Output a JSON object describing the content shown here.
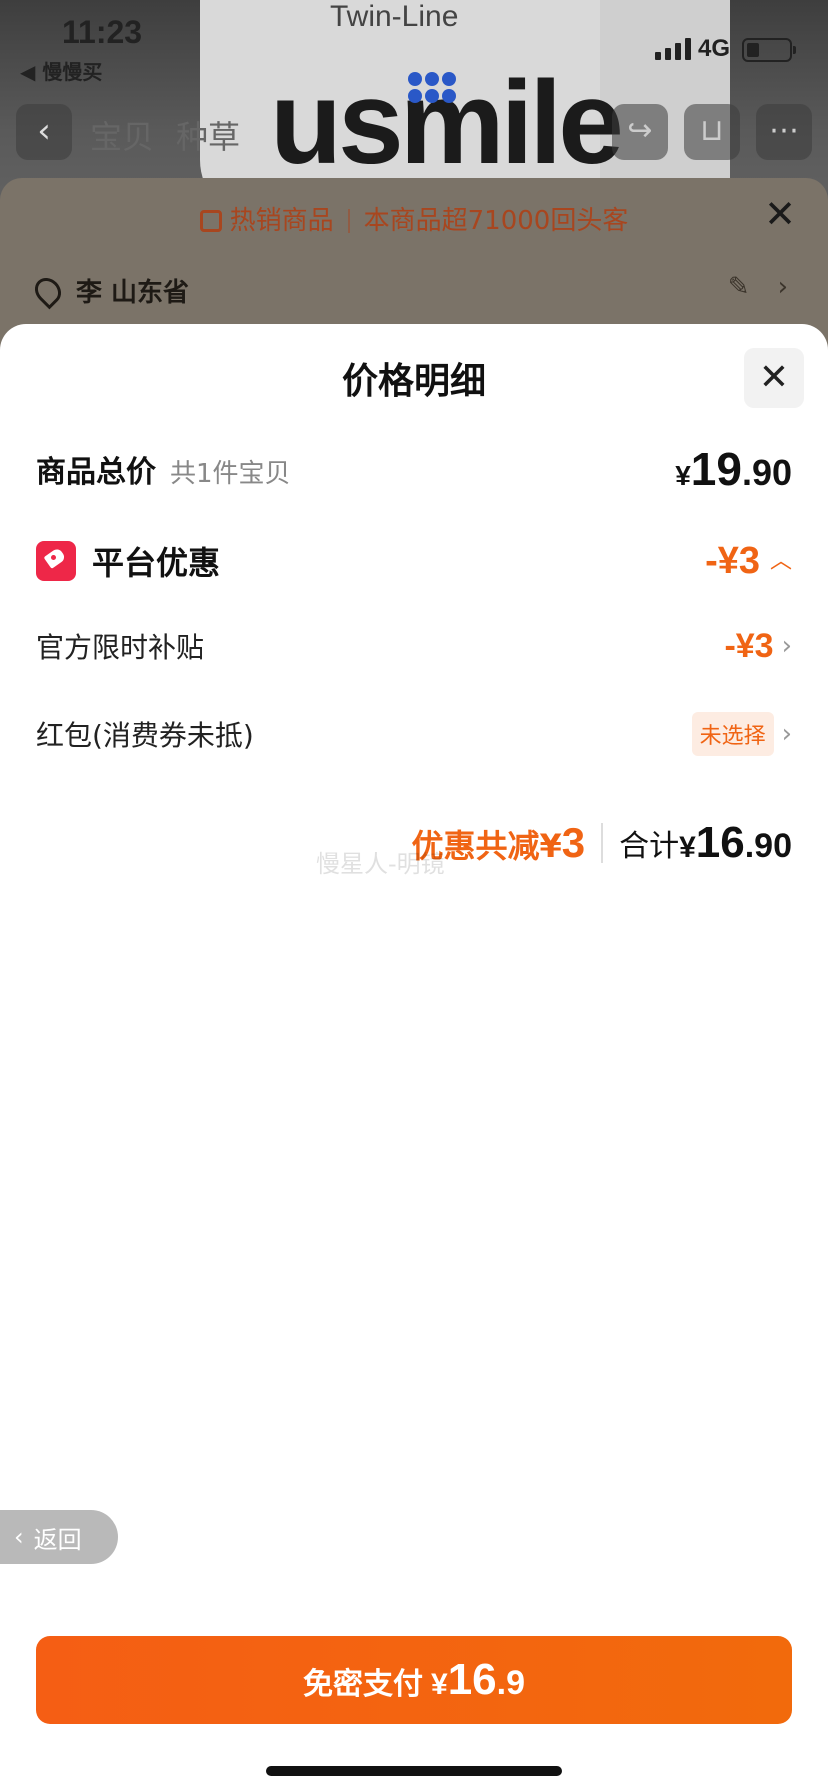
{
  "status": {
    "time": "11:23",
    "back_app": "◀ 慢慢买",
    "network": "4G"
  },
  "background": {
    "brand": "usmile",
    "subtitle": "Twin-Line",
    "nav_tabs": [
      "宝贝",
      "种草"
    ],
    "promo_label": "热销商品",
    "promo_detail": "本商品超71000回头客",
    "address": "李 山东省"
  },
  "sheet": {
    "title": "价格明细",
    "total": {
      "label": "商品总价",
      "sub": "共1件宝贝",
      "yen": "¥",
      "int": "19",
      "dec": ".90"
    },
    "platform": {
      "label": "平台优惠",
      "amount": "-¥3"
    },
    "subsidy": {
      "label": "官方限时补贴",
      "amount": "-¥3"
    },
    "redpack": {
      "label": "红包(消费券未抵)",
      "chip": "未选择"
    },
    "summary": {
      "save_label": "优惠共减¥",
      "save_num": "3",
      "sum_label": "合计",
      "yen": "¥",
      "int": "16",
      "dec": ".90"
    },
    "watermark": "慢星人-明镜"
  },
  "float_back": {
    "label": "返回"
  },
  "pay": {
    "label": "免密支付",
    "yen": "¥",
    "int": "16",
    "dec": ".9"
  },
  "colors": {
    "accent": "#f06414",
    "tag_red": "#ee2748",
    "pay_button": "#f55e14"
  },
  "icons": [
    "back-arrow-icon",
    "share-icon",
    "cart-icon",
    "more-icon",
    "bag-icon",
    "close-icon",
    "location-pin-icon",
    "edit-icon",
    "chevron-right-icon",
    "chevron-up-icon",
    "coupon-tag-icon"
  ]
}
